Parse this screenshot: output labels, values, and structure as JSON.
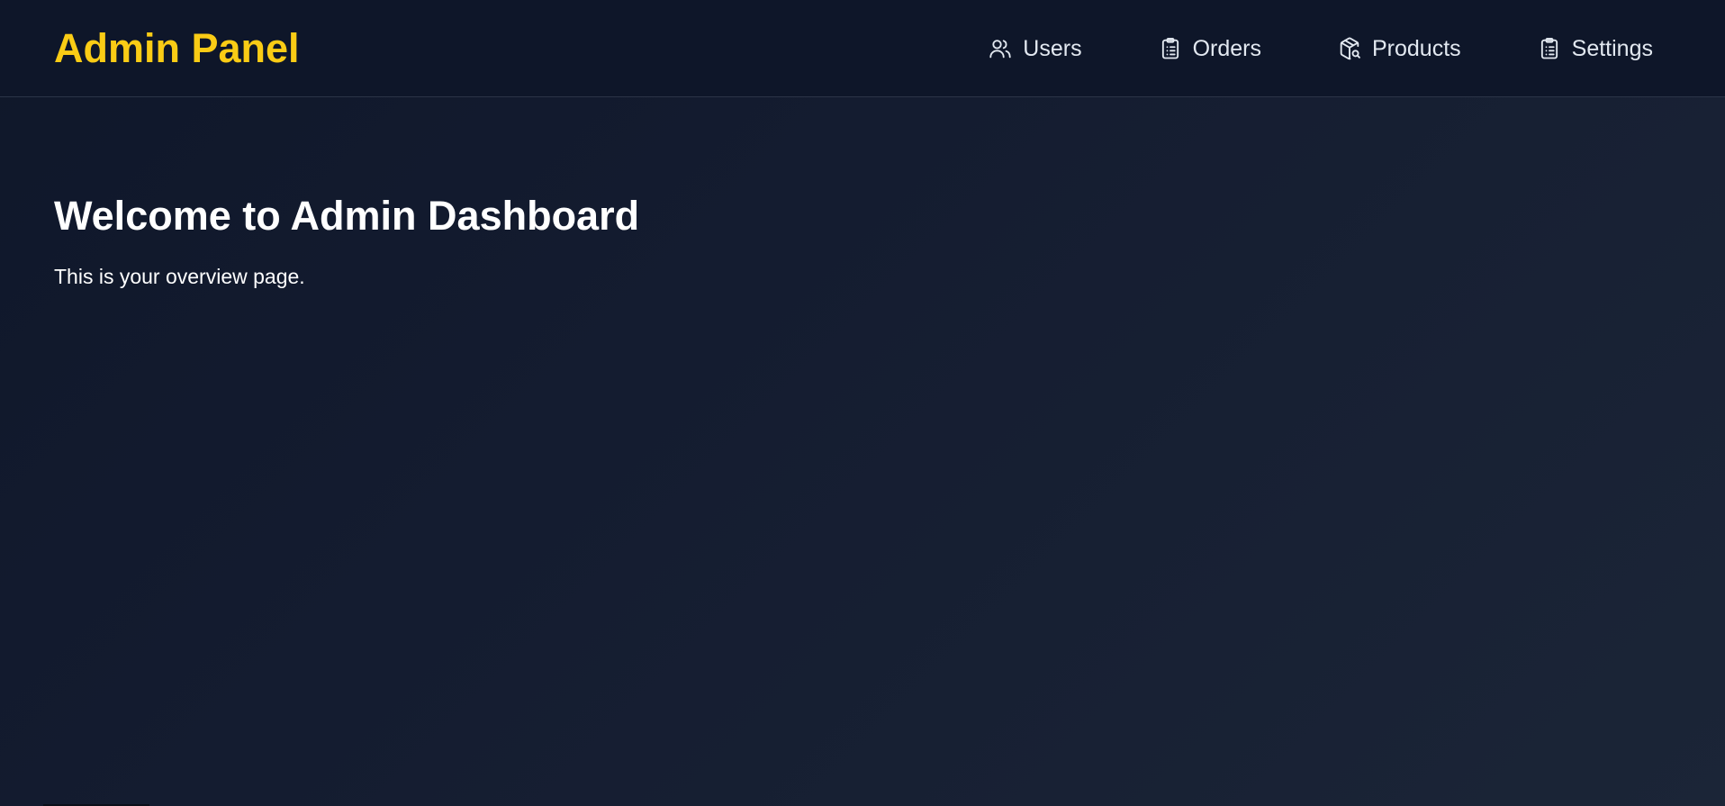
{
  "header": {
    "brand": "Admin Panel",
    "nav": [
      {
        "label": "Users",
        "icon": "users-icon"
      },
      {
        "label": "Orders",
        "icon": "clipboard-list-icon"
      },
      {
        "label": "Products",
        "icon": "package-search-icon"
      },
      {
        "label": "Settings",
        "icon": "clipboard-list-icon"
      }
    ]
  },
  "main": {
    "title": "Welcome to Admin Dashboard",
    "subtitle": "This is your overview page."
  },
  "colors": {
    "brand": "#facc15",
    "background": "#0f172a",
    "header_background": "#0e1629",
    "nav_text": "#e2e8f0",
    "text": "#ffffff"
  }
}
